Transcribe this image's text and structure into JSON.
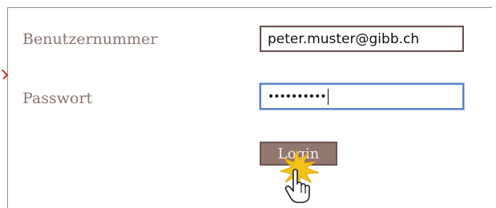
{
  "form": {
    "username_label": "Benutzernummer",
    "username_value": "peter.muster@gibb.ch",
    "password_label": "Passwort",
    "password_masked": "••••••••••",
    "login_label": "Login"
  },
  "colors": {
    "label_text": "#8a7470",
    "button_bg": "#927770",
    "button_border": "#6a5650",
    "focus_border": "#5a84c8",
    "click_burst": "#f2c418"
  },
  "icons": {
    "cursor": "hand-pointer-icon",
    "click": "click-burst-icon",
    "edge_marker": "arrow-right-icon"
  }
}
